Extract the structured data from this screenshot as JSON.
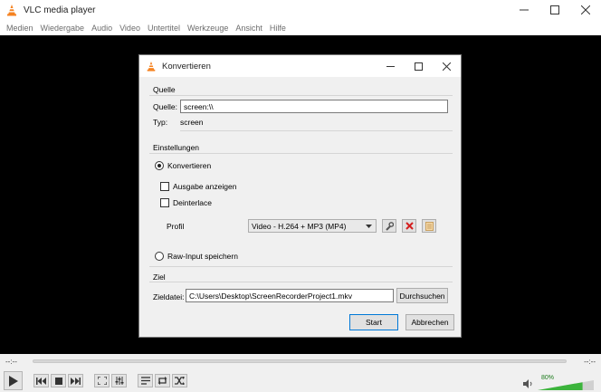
{
  "window": {
    "title": "VLC media player",
    "menu": [
      "Medien",
      "Wiedergabe",
      "Audio",
      "Video",
      "Untertitel",
      "Werkzeuge",
      "Ansicht",
      "Hilfe"
    ]
  },
  "player": {
    "time_elapsed": "--:--",
    "time_total": "--:--",
    "volume_label": "80%",
    "volume_level": 0.8
  },
  "dialog": {
    "title": "Konvertieren",
    "source": {
      "group_label": "Quelle",
      "source_label": "Quelle:",
      "source_value": "screen:\\\\",
      "type_label": "Typ:",
      "type_value": "screen"
    },
    "settings": {
      "group_label": "Einstellungen",
      "convert_label": "Konvertieren",
      "convert_selected": true,
      "show_output_label": "Ausgabe anzeigen",
      "show_output_checked": false,
      "deinterlace_label": "Deinterlace",
      "deinterlace_checked": false,
      "profile_label": "Profil",
      "profile_value": "Video - H.264 + MP3 (MP4)",
      "raw_input_label": "Raw-Input speichern",
      "raw_input_selected": false
    },
    "target": {
      "group_label": "Ziel",
      "file_label": "Zieldatei:",
      "file_value": "C:\\Users\\Desktop\\ScreenRecorderProject1.mkv",
      "browse_label": "Durchsuchen"
    },
    "start_label": "Start",
    "cancel_label": "Abbrechen"
  },
  "colors": {
    "vlc_orange": "#f58220",
    "delete_red": "#d42020",
    "volume_green": "#3cb43c"
  }
}
